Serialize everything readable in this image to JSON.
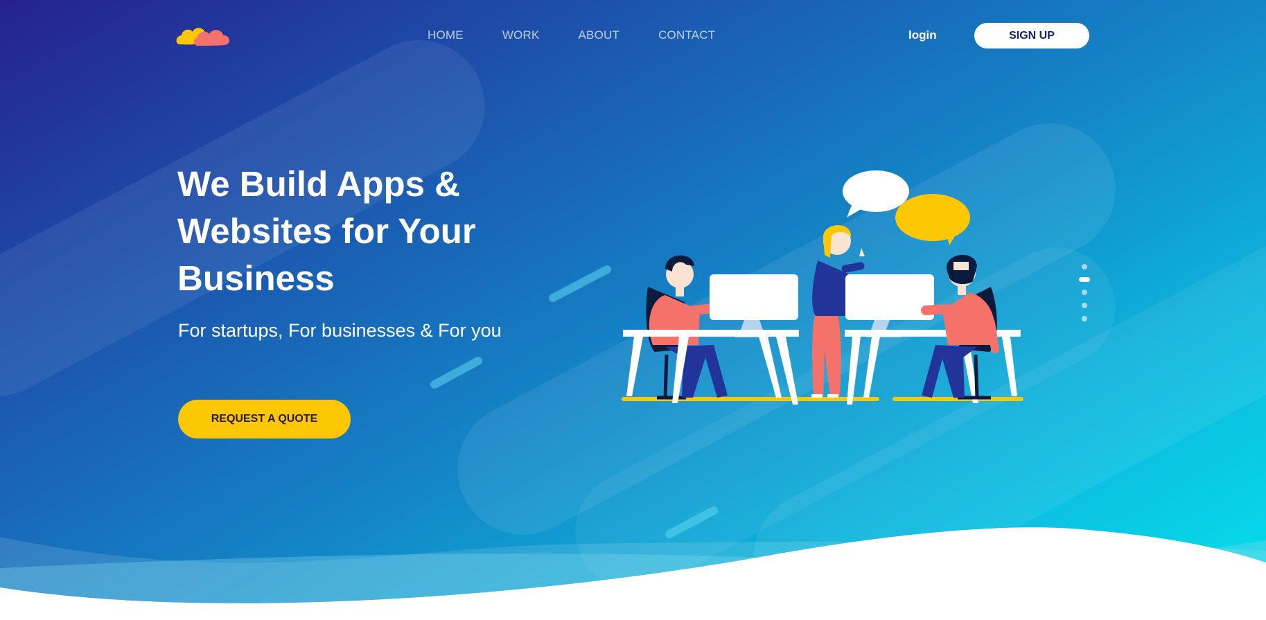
{
  "brand": {
    "logo": "two-clouds-logo",
    "colors": {
      "yellow": "#fdc703",
      "coral": "#f4726a",
      "navy": "#25218f",
      "cyan": "#05e2ec"
    }
  },
  "nav": {
    "items": [
      {
        "label": "HOME"
      },
      {
        "label": "WORK"
      },
      {
        "label": "ABOUT"
      },
      {
        "label": "CONTACT"
      }
    ],
    "login_label": "login",
    "signup_label": "SIGN UP"
  },
  "hero": {
    "headline_lines": [
      "We Build Apps &",
      "Websites for Your",
      "Business"
    ],
    "subtitle": "For startups, For businesses & For you",
    "cta_label": "REQUEST A QUOTE",
    "illustration": "team-working-at-desks-illustration"
  },
  "slider": {
    "slide_count": 5,
    "active_slide": 2
  }
}
